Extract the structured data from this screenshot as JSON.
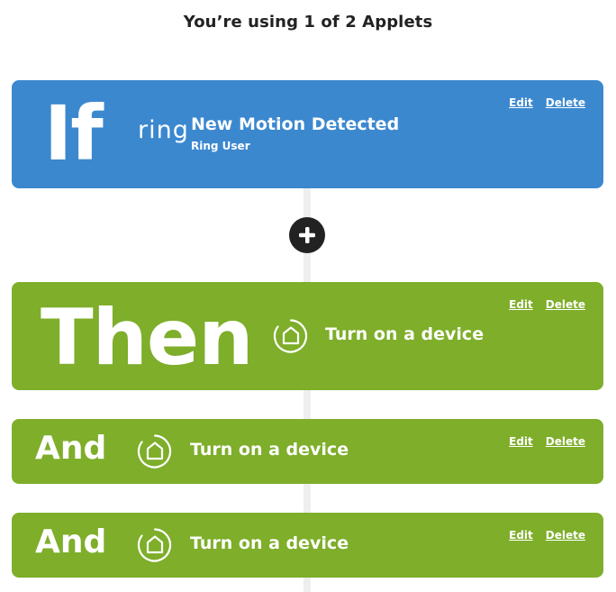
{
  "header": {
    "title": "You’re using 1 of 2 Applets"
  },
  "trigger": {
    "keyword": "If",
    "service_logo": "ring",
    "title": "New Motion Detected",
    "subtitle": "Ring User",
    "edit_label": "Edit",
    "delete_label": "Delete",
    "color": "#3b88cf"
  },
  "add_button": {
    "icon": "plus-icon"
  },
  "actions": [
    {
      "keyword": "Then",
      "icon": "smart-home-icon",
      "title": "Turn on a device",
      "edit_label": "Edit",
      "delete_label": "Delete",
      "color": "#7eae2a"
    },
    {
      "keyword": "And",
      "icon": "smart-home-icon",
      "title": "Turn on a device",
      "edit_label": "Edit",
      "delete_label": "Delete",
      "color": "#7eae2a"
    },
    {
      "keyword": "And",
      "icon": "smart-home-icon",
      "title": "Turn on a device",
      "edit_label": "Edit",
      "delete_label": "Delete",
      "color": "#7eae2a"
    }
  ]
}
